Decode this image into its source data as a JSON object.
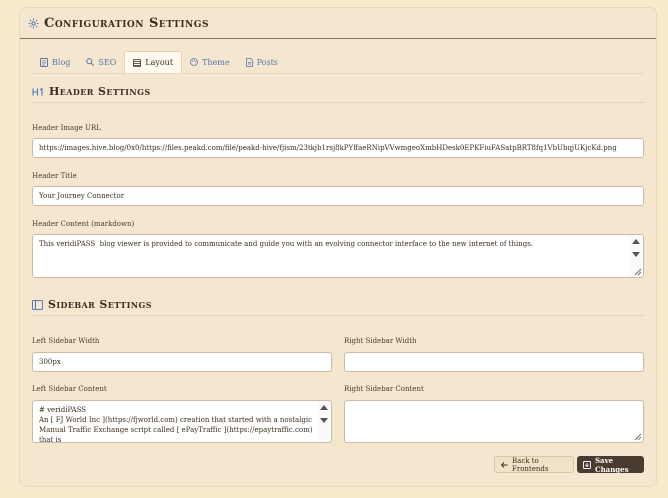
{
  "header": {
    "title": "Configuration Settings"
  },
  "tabs": [
    {
      "label": "Blog",
      "icon": "document-icon"
    },
    {
      "label": "SEO",
      "icon": "search-icon"
    },
    {
      "label": "Layout",
      "icon": "layout-icon",
      "active": true
    },
    {
      "label": "Theme",
      "icon": "palette-icon"
    },
    {
      "label": "Posts",
      "icon": "file-icon"
    }
  ],
  "header_settings": {
    "title": "Header Settings",
    "image_url_label": "Header Image URL",
    "image_url_value": "https://images.hive.blog/0x0/https://files.peakd.com/file/peakd-hive/fjism/23tkjb1rsj8kPYffaeRNipVVwmgeoXmbHDesk0EPKFiuFASatpBRT8fq1VbUbqjUKjcKd.png",
    "title_label": "Header Title",
    "title_value": "Your Journey Connector",
    "content_label": "Header Content (markdown)",
    "content_value": "This veridiPASS  blog viewer is provided to communicate and guide you with an evolving connector interface to the new internet of things."
  },
  "sidebar_settings": {
    "title": "Sidebar Settings",
    "left_width_label": "Left Sidebar Width",
    "left_width_value": "300px",
    "right_width_label": "Right Sidebar Width",
    "right_width_value": "",
    "left_content_label": "Left Sidebar Content",
    "left_content_value": "# veridiPASS\nAn [ FJ World Inc ](https://fjworld.com) creation that started with a nostalgic Manual Traffic Exchange script called [ ePayTraffic ](https://epaytraffic.com) that is",
    "right_content_label": "Right Sidebar Content",
    "right_content_value": ""
  },
  "footer": {
    "back_label": "Back to Frontends",
    "save_label": "Save Changes"
  },
  "colors": {
    "page_bg": "#f7ebcd",
    "panel_bg": "#f5e6d0",
    "tab_link": "#5577aa",
    "save_button": "#4a3b30",
    "accent_icon": "#4f7bbd"
  }
}
